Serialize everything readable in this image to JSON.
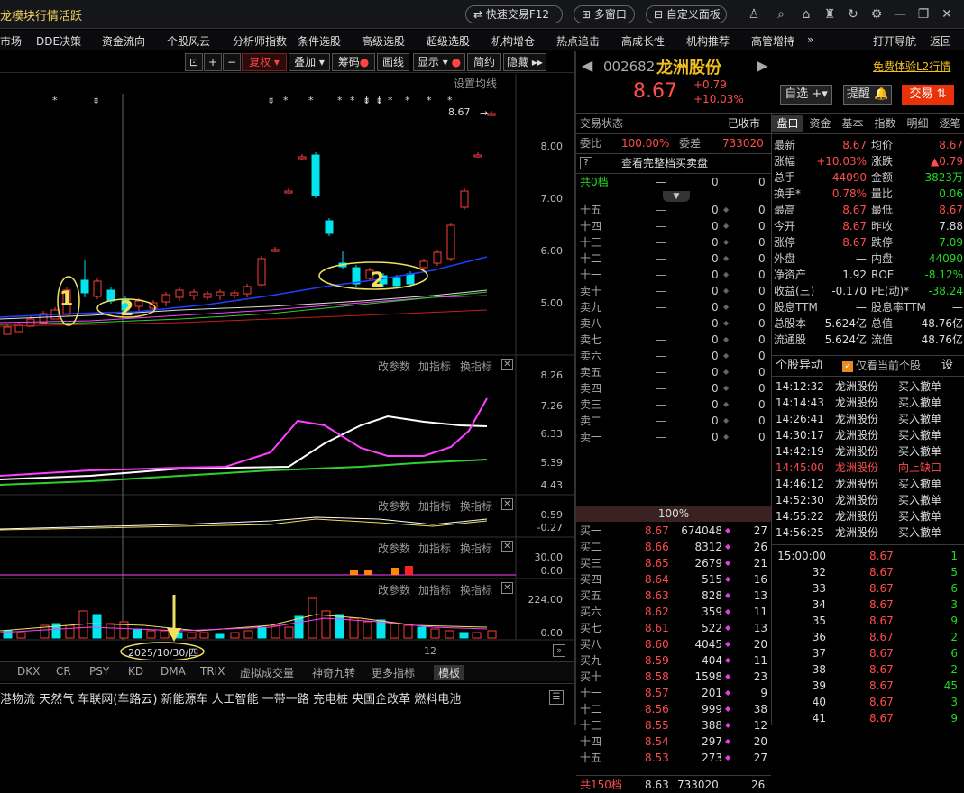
{
  "titlebar": {
    "title": "龙模块行情活跃",
    "quick_trade": "快速交易F12",
    "multi_window": "多窗口",
    "custom_panel": "自定义面板"
  },
  "menu": [
    "市场",
    "DDE决策",
    "资金流向",
    "个股风云",
    "分析师指数",
    "条件选股",
    "高级选股",
    "超级选股",
    "机构增仓",
    "热点追击",
    "高成长性",
    "机构推荐",
    "高管增持",
    "»",
    "打开导航",
    "返回"
  ],
  "toolbar": {
    "restore": "复权",
    "overlay": "叠加",
    "chips": "筹码",
    "draw": "画线",
    "display": "显示",
    "simple": "简约",
    "hide": "隐藏"
  },
  "chart": {
    "ma_setting": "设置均线",
    "price_now": "8.67",
    "k_ticks": [
      "8.00",
      "7.00",
      "6.00",
      "5.00"
    ],
    "ann1": "1",
    "ann2": "2",
    "ann3": "2",
    "p2_links": [
      "改参数",
      "加指标",
      "换指标"
    ],
    "p2_ticks": [
      "8.26",
      "7.26",
      "6.33",
      "5.39",
      "4.43"
    ],
    "p3_ticks": [
      "0.59",
      "-0.27"
    ],
    "p4_ticks": [
      "30.00",
      "0.00"
    ],
    "p5_ticks": [
      "224.00",
      "0.00"
    ],
    "date_label": "2025/10/30/四",
    "month_label": "12"
  },
  "bottom_tabs": [
    "DKX",
    "CR",
    "PSY",
    "KD",
    "DMA",
    "TRIX",
    "虚拟成交量",
    "神奇九转",
    "更多指标",
    "模板"
  ],
  "ticker": "港物流 天然气 车联网(车路云) 新能源车 人工智能 一带一路 充电桩 央国企改革 燃料电池",
  "stock": {
    "code": "002682",
    "name": "龙洲股份",
    "price": "8.67",
    "change": "+0.79",
    "pct": "+10.03%",
    "l2": "免费体验L2行情",
    "btn_fav": "自选",
    "btn_alert": "提醒",
    "btn_trade": "交易"
  },
  "order": {
    "status_label": "交易状态",
    "status": "已收市",
    "wb_label": "委比",
    "wb": "100.00%",
    "wc_label": "委差",
    "wc": "733020",
    "full_book": "查看完整档买卖盘",
    "total_label": "共0档",
    "total_dash": "—",
    "total_v1": "0",
    "total_v2": "0",
    "sells": [
      [
        "十五",
        "—",
        "0"
      ],
      [
        "十四",
        "—",
        "0"
      ],
      [
        "十三",
        "—",
        "0"
      ],
      [
        "十二",
        "—",
        "0"
      ],
      [
        "十一",
        "—",
        "0"
      ],
      [
        "卖十",
        "—",
        "0"
      ],
      [
        "卖九",
        "—",
        "0"
      ],
      [
        "卖八",
        "—",
        "0"
      ],
      [
        "卖七",
        "—",
        "0"
      ],
      [
        "卖六",
        "—",
        "0"
      ],
      [
        "卖五",
        "—",
        "0"
      ],
      [
        "卖四",
        "—",
        "0"
      ],
      [
        "卖三",
        "—",
        "0"
      ],
      [
        "卖二",
        "—",
        "0"
      ],
      [
        "卖一",
        "—",
        "0"
      ]
    ],
    "mid": "100%",
    "buys": [
      [
        "买一",
        "8.67",
        "674048",
        "27"
      ],
      [
        "买二",
        "8.66",
        "8312",
        "26"
      ],
      [
        "买三",
        "8.65",
        "2679",
        "21"
      ],
      [
        "买四",
        "8.64",
        "515",
        "16"
      ],
      [
        "买五",
        "8.63",
        "828",
        "13"
      ],
      [
        "买六",
        "8.62",
        "359",
        "11"
      ],
      [
        "买七",
        "8.61",
        "522",
        "13"
      ],
      [
        "买八",
        "8.60",
        "4045",
        "20"
      ],
      [
        "买九",
        "8.59",
        "404",
        "11"
      ],
      [
        "买十",
        "8.58",
        "1598",
        "23"
      ],
      [
        "十一",
        "8.57",
        "201",
        "9"
      ],
      [
        "十二",
        "8.56",
        "999",
        "38"
      ],
      [
        "十三",
        "8.55",
        "388",
        "12"
      ],
      [
        "十四",
        "8.54",
        "297",
        "20"
      ],
      [
        "十五",
        "8.53",
        "273",
        "27"
      ]
    ],
    "footer": [
      "共150档",
      "8.63",
      "733020",
      "26"
    ]
  },
  "quote": {
    "tabs": [
      "盘口",
      "资金",
      "基本",
      "指数",
      "明细",
      "逐笔"
    ],
    "rows": [
      [
        "最新",
        "8.67",
        "均价",
        "8.67"
      ],
      [
        "涨幅",
        "+10.03%",
        "涨跌",
        "▲0.79"
      ],
      [
        "总手",
        "44090",
        "金额",
        "3823万"
      ],
      [
        "换手*",
        "0.78%",
        "量比",
        "0.06"
      ],
      [
        "最高",
        "8.67",
        "最低",
        "8.67"
      ],
      [
        "今开",
        "8.67",
        "昨收",
        "7.88"
      ],
      [
        "涨停",
        "8.67",
        "跌停",
        "7.09"
      ],
      [
        "外盘",
        "—",
        "内盘",
        "44090"
      ],
      [
        "净资产",
        "1.92",
        "ROE",
        "-8.12%"
      ],
      [
        "收益(三)",
        "-0.170",
        "PE(动)*",
        "-38.24"
      ],
      [
        "股息TTM",
        "—",
        "股息率TTM",
        "—"
      ],
      [
        "总股本",
        "5.624亿",
        "总值",
        "48.76亿"
      ],
      [
        "流通股",
        "5.624亿",
        "流值",
        "48.76亿"
      ]
    ]
  },
  "anomaly": {
    "title": "个股异动",
    "checkbox": "仅看当前个股",
    "set": "设",
    "rows": [
      [
        "14:12:32",
        "龙洲股份",
        "买入撤单"
      ],
      [
        "14:14:43",
        "龙洲股份",
        "买入撤单"
      ],
      [
        "14:26:41",
        "龙洲股份",
        "买入撤单"
      ],
      [
        "14:30:17",
        "龙洲股份",
        "买入撤单"
      ],
      [
        "14:42:19",
        "龙洲股份",
        "买入撤单"
      ],
      [
        "14:45:00",
        "龙洲股份",
        "向上缺口"
      ],
      [
        "14:46:12",
        "龙洲股份",
        "买入撤单"
      ],
      [
        "14:52:30",
        "龙洲股份",
        "买入撤单"
      ],
      [
        "14:55:22",
        "龙洲股份",
        "买入撤单"
      ],
      [
        "14:56:25",
        "龙洲股份",
        "买入撤单"
      ]
    ]
  },
  "ticks": [
    [
      "15:00:00",
      "8.67",
      "1"
    ],
    [
      "32",
      "8.67",
      "5"
    ],
    [
      "33",
      "8.67",
      "6"
    ],
    [
      "34",
      "8.67",
      "3"
    ],
    [
      "35",
      "8.67",
      "9"
    ],
    [
      "36",
      "8.67",
      "2"
    ],
    [
      "37",
      "8.67",
      "6"
    ],
    [
      "38",
      "8.67",
      "2"
    ],
    [
      "39",
      "8.67",
      "45"
    ],
    [
      "40",
      "8.67",
      "3"
    ],
    [
      "41",
      "8.67",
      "9"
    ]
  ]
}
